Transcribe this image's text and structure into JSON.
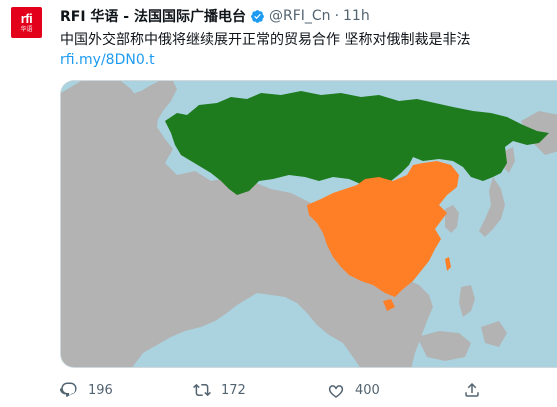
{
  "author": {
    "logo_text": "rfi",
    "logo_subtext": "华语",
    "name": "RFI 华语 - 法国国际广播电台",
    "handle": "@RFI_Cn",
    "separator": "·",
    "time": "11h"
  },
  "tweet": {
    "text": "中国外交部称中俄将继续展开正常的贸易合作 坚称对俄制裁是非法",
    "link": "rfi.my/8DN0.t"
  },
  "map": {
    "colors": {
      "water": "#aad3df",
      "land": "#b3b3b3",
      "russia": "#1e7b1e",
      "china": "#ff7f27"
    }
  },
  "actions": {
    "reply": {
      "icon": "reply-icon",
      "count": "196"
    },
    "retweet": {
      "icon": "retweet-icon",
      "count": "172"
    },
    "like": {
      "icon": "like-icon",
      "count": "400"
    },
    "share": {
      "icon": "share-icon"
    }
  }
}
